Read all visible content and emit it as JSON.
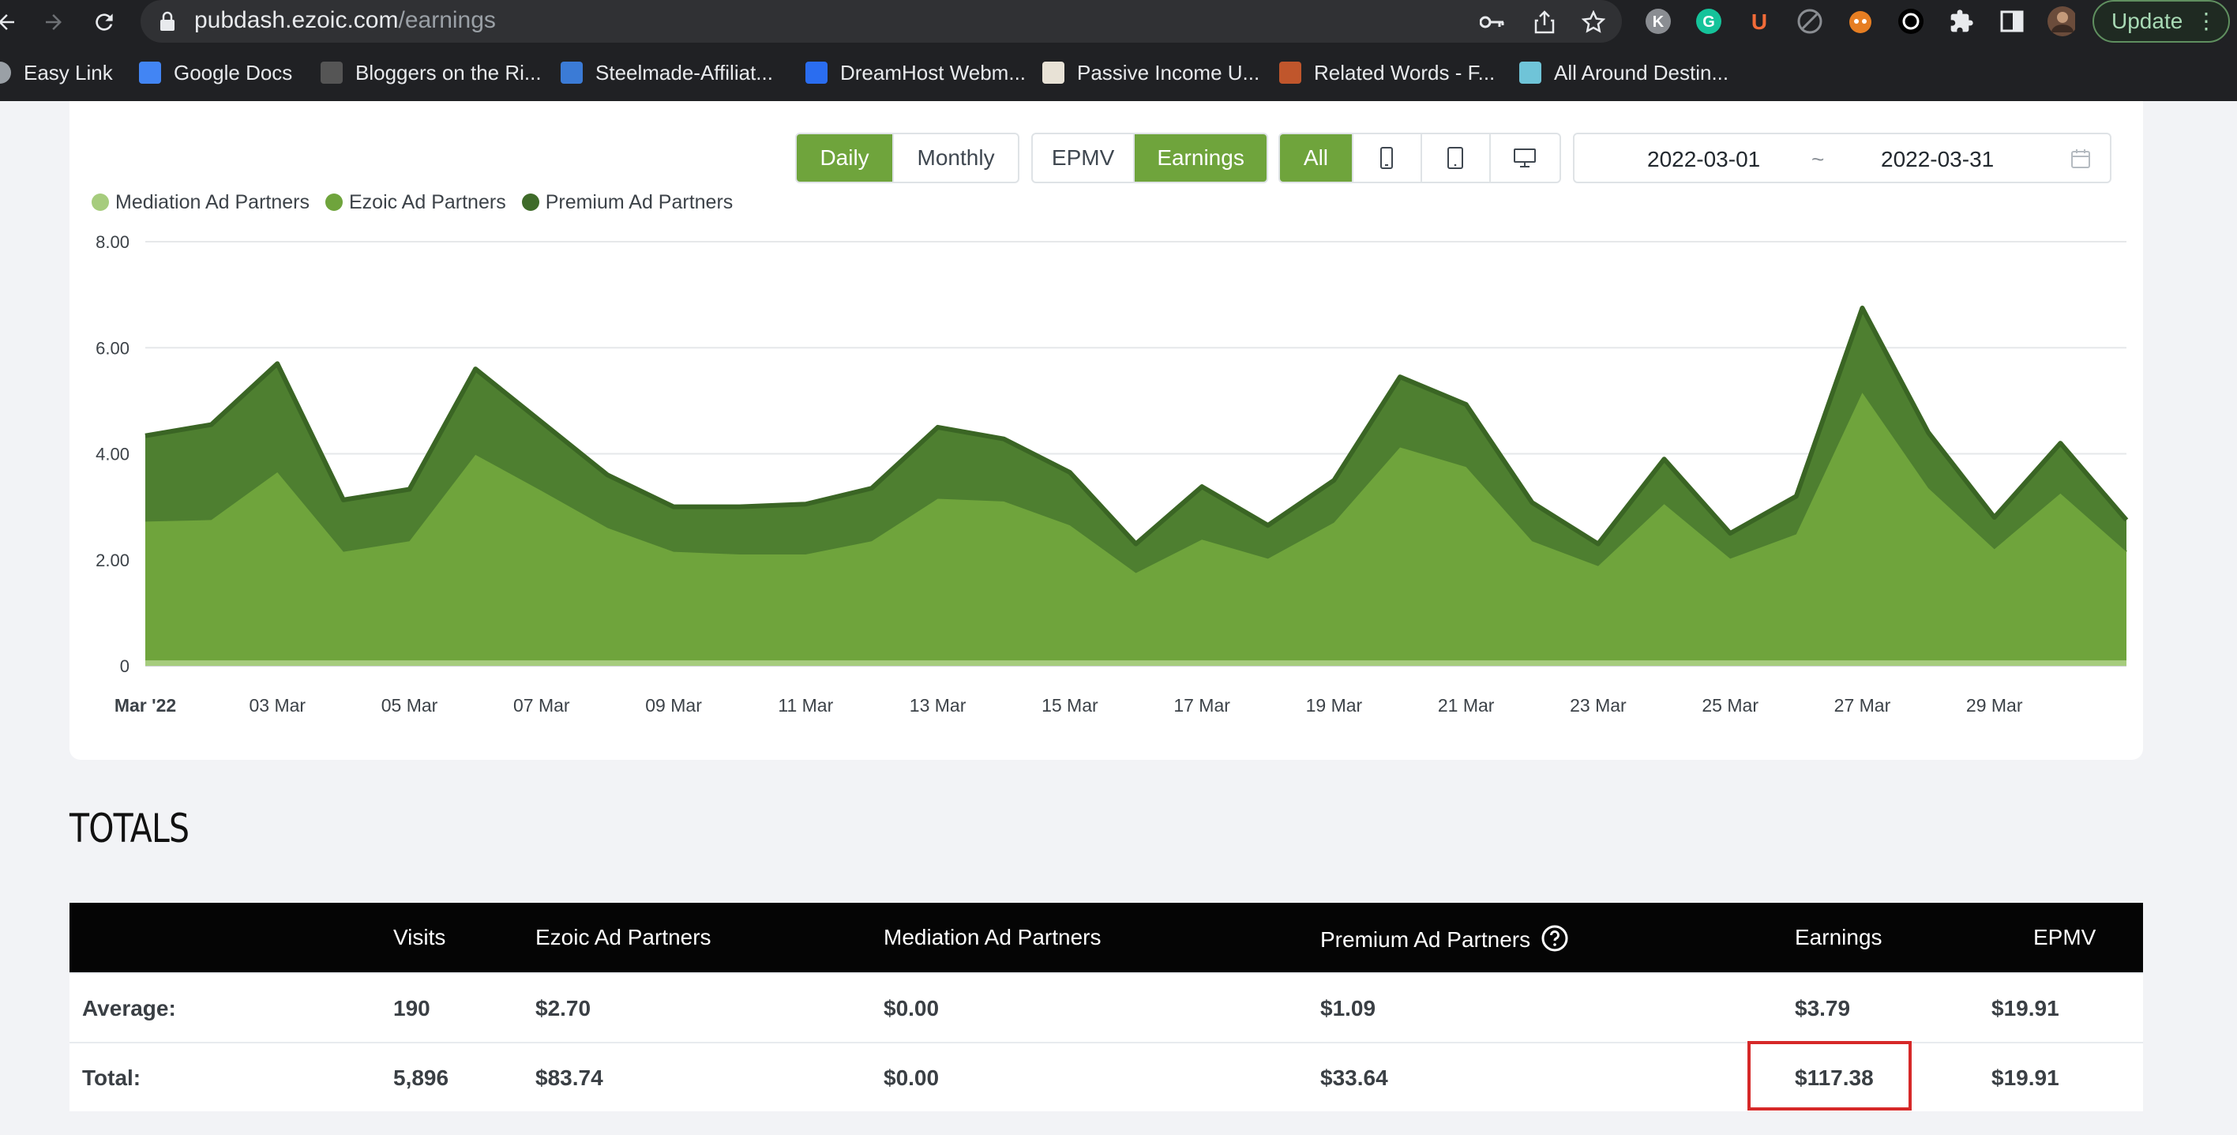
{
  "browser": {
    "url_host": "pubdash.ezoic.com",
    "url_path": "/earnings",
    "update_label": "Update",
    "bookmarks": [
      {
        "label": "Easy Link",
        "icon": "globe-icon",
        "color": "#9aa0a6"
      },
      {
        "label": "Google Docs",
        "icon": "google-docs-icon",
        "color": "#4285f4"
      },
      {
        "label": "Bloggers on the Ri...",
        "icon": "bloggers-icon",
        "color": "#555555"
      },
      {
        "label": "Steelmade-Affiliat...",
        "icon": "steelmade-icon",
        "color": "#3b7bd6"
      },
      {
        "label": "DreamHost Webm...",
        "icon": "dreamhost-icon",
        "color": "#2a6df0"
      },
      {
        "label": "Passive Income U...",
        "icon": "passive-income-icon",
        "color": "#e8e2d6"
      },
      {
        "label": "Related Words - F...",
        "icon": "related-words-icon",
        "color": "#c0562c"
      },
      {
        "label": "All Around Destin...",
        "icon": "all-around-icon",
        "color": "#6fc4d8"
      }
    ]
  },
  "controls": {
    "period": [
      "Daily",
      "Monthly"
    ],
    "period_selected": "Daily",
    "metric": [
      "EPMV",
      "Earnings"
    ],
    "metric_selected": "Earnings",
    "device_all": "All",
    "device_icons": [
      "mobile-icon",
      "tablet-icon",
      "desktop-icon"
    ],
    "date_start": "2022-03-01",
    "date_separator": "~",
    "date_end": "2022-03-31"
  },
  "chart_data": {
    "type": "area",
    "stacked": true,
    "legend": [
      "Mediation Ad Partners",
      "Ezoic Ad Partners",
      "Premium Ad Partners"
    ],
    "legend_colors": [
      "#a6cc7d",
      "#6fa43c",
      "#3f6b2a"
    ],
    "ylim": [
      0,
      8
    ],
    "y_ticks": [
      "0",
      "2.00",
      "4.00",
      "6.00",
      "8.00"
    ],
    "x_days": [
      1,
      2,
      3,
      4,
      5,
      6,
      7,
      8,
      9,
      10,
      11,
      12,
      13,
      14,
      15,
      16,
      17,
      18,
      19,
      20,
      21,
      22,
      23,
      24,
      25,
      26,
      27,
      28,
      29,
      30,
      31
    ],
    "x_tick_labels": [
      {
        "day": 1,
        "label": "Mar '22",
        "bold": true
      },
      {
        "day": 3,
        "label": "03 Mar"
      },
      {
        "day": 5,
        "label": "05 Mar"
      },
      {
        "day": 7,
        "label": "07 Mar"
      },
      {
        "day": 9,
        "label": "09 Mar"
      },
      {
        "day": 11,
        "label": "11 Mar"
      },
      {
        "day": 13,
        "label": "13 Mar"
      },
      {
        "day": 15,
        "label": "15 Mar"
      },
      {
        "day": 17,
        "label": "17 Mar"
      },
      {
        "day": 19,
        "label": "19 Mar"
      },
      {
        "day": 21,
        "label": "21 Mar"
      },
      {
        "day": 23,
        "label": "23 Mar"
      },
      {
        "day": 25,
        "label": "25 Mar"
      },
      {
        "day": 27,
        "label": "27 Mar"
      },
      {
        "day": 29,
        "label": "29 Mar"
      }
    ],
    "series": [
      {
        "name": "Mediation Ad Partners",
        "color": "#a6cc7d",
        "values": [
          0.1,
          0.1,
          0.1,
          0.1,
          0.1,
          0.1,
          0.1,
          0.1,
          0.1,
          0.1,
          0.1,
          0.1,
          0.1,
          0.1,
          0.1,
          0.1,
          0.1,
          0.1,
          0.1,
          0.1,
          0.1,
          0.1,
          0.1,
          0.1,
          0.1,
          0.1,
          0.1,
          0.1,
          0.1,
          0.1,
          0.1
        ]
      },
      {
        "name": "Ezoic Ad Partners",
        "color": "#6fa43c",
        "values": [
          2.62,
          2.65,
          3.55,
          2.05,
          2.25,
          3.88,
          3.2,
          2.5,
          2.05,
          2.0,
          2.0,
          2.25,
          3.05,
          3.0,
          2.55,
          1.65,
          2.28,
          1.92,
          2.6,
          4.02,
          3.65,
          2.25,
          1.78,
          2.95,
          1.92,
          2.38,
          5.05,
          3.25,
          2.1,
          3.15,
          2.05
        ]
      },
      {
        "name": "Premium Ad Partners",
        "color": "#4e7f30",
        "values": [
          1.62,
          1.8,
          2.05,
          0.98,
          0.98,
          1.62,
          1.3,
          1.0,
          0.85,
          0.9,
          0.95,
          1.0,
          1.35,
          1.18,
          1.0,
          0.55,
          1.0,
          0.63,
          0.8,
          1.33,
          1.18,
          0.73,
          0.42,
          0.85,
          0.48,
          0.72,
          1.6,
          1.05,
          0.6,
          0.95,
          0.6
        ]
      }
    ]
  },
  "totals": {
    "title": "TOTALS",
    "help_icon": "question-circle-icon",
    "headers": [
      "",
      "Visits",
      "Ezoic Ad Partners",
      "Mediation Ad Partners",
      "Premium Ad Partners",
      "Earnings",
      "EPMV"
    ],
    "rows": [
      {
        "label": "Average:",
        "visits": "190",
        "ezoic": "$2.70",
        "mediation": "$0.00",
        "premium": "$1.09",
        "earnings": "$3.79",
        "epmv": "$19.91"
      },
      {
        "label": "Total:",
        "visits": "5,896",
        "ezoic": "$83.74",
        "mediation": "$0.00",
        "premium": "$33.64",
        "earnings": "$117.38",
        "epmv": "$19.91"
      }
    ],
    "highlight_color": "#d62828"
  }
}
